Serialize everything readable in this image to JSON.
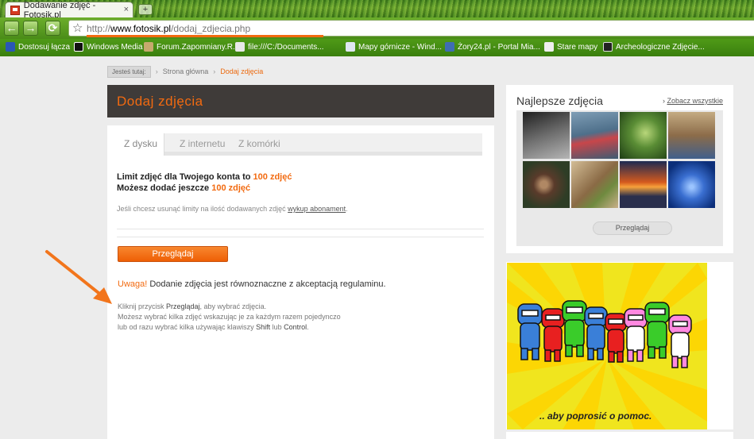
{
  "browser": {
    "tab_title": "Dodawanie zdjęć - Fotosik.pl",
    "tab_close": "×",
    "newtab": "+",
    "back": "←",
    "forward": "→",
    "reload": "⟳",
    "star": "☆",
    "url_scheme": "http://",
    "url_domain": "www.fotosik.pl",
    "url_path": "/dodaj_zdjecia.php"
  },
  "bookmarks": [
    {
      "label": "Dostosuj łącza",
      "color": "#2a57b5"
    },
    {
      "label": "Windows Media",
      "color": "#111111"
    },
    {
      "label": "Forum.Zapomniany.R...",
      "color": "#c7a96e"
    },
    {
      "label": "file:///C:/Documents...",
      "color": "#e8e8e8"
    },
    {
      "label": "Mapy górnicze - Wind...",
      "color": "#dfe6f2"
    },
    {
      "label": "Żory24.pl - Portal Mia...",
      "color": "#3f6db3"
    },
    {
      "label": "Stare mapy",
      "color": "#eeeeee"
    },
    {
      "label": "Archeologiczne Zdjęcie...",
      "color": "#222222"
    }
  ],
  "breadcrumb": {
    "you_are_here": "Jesteś tutaj:",
    "home": "Strona główna",
    "current": "Dodaj zdjęcia"
  },
  "main": {
    "title": "Dodaj zdjęcia",
    "tabs": [
      "Z dysku",
      "Z internetu",
      "Z komórki"
    ],
    "limit_line1_prefix": "Limit zdjęć dla Twojego konta to ",
    "limit_line1_value": "100 zdjęć",
    "limit_line2_prefix": "Możesz dodać jeszcze ",
    "limit_line2_value": "100 zdjęć",
    "hint_prefix": "Jeśli chcesz usunąć limity na ilość dodawanych zdjęć ",
    "hint_link": "wykup abonament",
    "hint_suffix": ".",
    "browse_label": "Przeglądaj",
    "warn_label": "Uwaga!",
    "warn_text": " Dodanie zdjęcia jest równoznaczne z akceptacją regulaminu.",
    "instr_1a": "Kliknij przycisk ",
    "instr_1b": "Przeglądaj",
    "instr_1c": ", aby wybrać zdjęcia.",
    "instr_2": "Możesz wybrać kilka zdjęć wskazując je za każdym razem pojedynczo",
    "instr_3a": "lub od razu wybrać kilka używając klawiszy ",
    "instr_3b": "Shift",
    "instr_3c": " lub ",
    "instr_3d": "Control",
    "instr_3e": "."
  },
  "sidebar": {
    "best_title": "Najlepsze zdjęcia",
    "see_all": "Zobacz wszystkie",
    "see_all_icon": "›",
    "browse_label": "Przeglądaj",
    "thumbs": [
      {
        "name": "thumb-building",
        "c1": "#2c2c2c",
        "c2": "#9a9a9a"
      },
      {
        "name": "thumb-kayak",
        "c1": "#5c7f9c",
        "c2": "#c8464a"
      },
      {
        "name": "thumb-leaf",
        "c1": "#2e5a23",
        "c2": "#a9c86a"
      },
      {
        "name": "thumb-beach-people",
        "c1": "#b79a70",
        "c2": "#3f5f8c"
      },
      {
        "name": "thumb-portrait",
        "c1": "#2e3d26",
        "c2": "#a7825c"
      },
      {
        "name": "thumb-grasshopper",
        "c1": "#7a5c3a",
        "c2": "#c9b08a"
      },
      {
        "name": "thumb-sunset",
        "c1": "#1d2a52",
        "c2": "#f08a2e"
      },
      {
        "name": "thumb-dragonfly",
        "c1": "#0c2f7a",
        "c2": "#4f8ee0"
      }
    ]
  },
  "ad": {
    "caption": ".. aby poprosić o pomoc.",
    "ninjas": [
      "#3a7fd8",
      "#e82020",
      "#3acc2a",
      "#3a7fd8",
      "#e82020",
      "#ff88e0",
      "#3acc2a",
      "#ff88e0"
    ],
    "bg": "#f0e51e"
  },
  "colors": {
    "accent": "#f26a10",
    "titlebar_bg": "#3f3b39"
  }
}
